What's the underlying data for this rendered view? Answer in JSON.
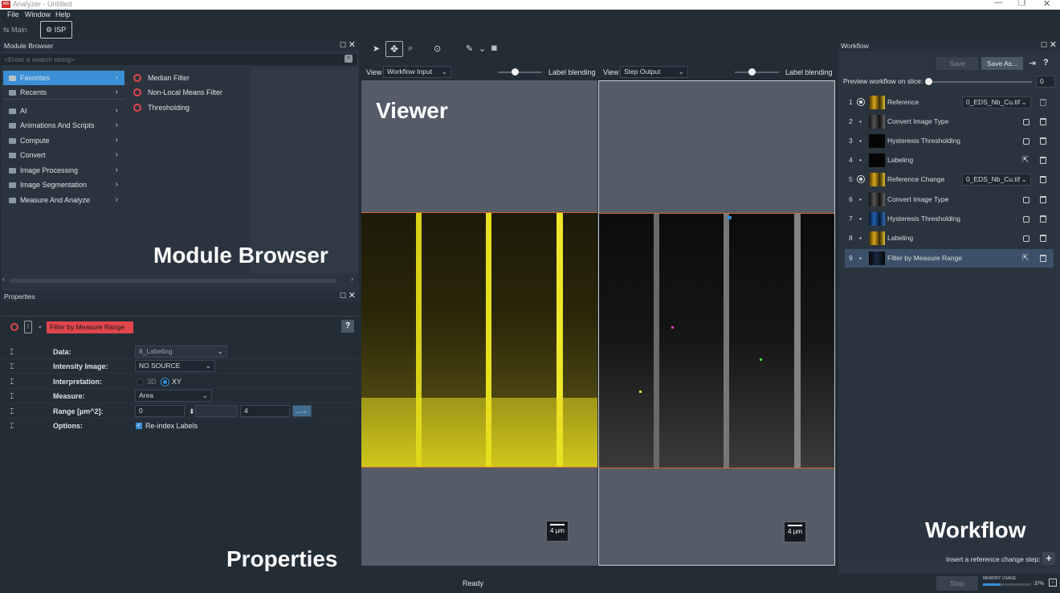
{
  "window": {
    "title": "Analyzer - Untitled",
    "icon_label": "ABI"
  },
  "menu": [
    "File",
    "Window",
    "Help"
  ],
  "perspectives": {
    "main": "Main",
    "isp": "ISP"
  },
  "module_browser": {
    "title": "Module Browser",
    "search_placeholder": "<Enter a search string>",
    "categories": [
      "Favorites",
      "Recents",
      "AI",
      "Animations And Scripts",
      "Compute",
      "Convert",
      "Image Processing",
      "Image Segmentation",
      "Measure And Analyze"
    ],
    "favorites": [
      "Median Filter",
      "Non-Local Means Filter",
      "Thresholding"
    ],
    "overlay_label": "Module Browser"
  },
  "properties": {
    "title": "Properties",
    "module_name": "Filter by Measure Range",
    "fields": [
      {
        "label": "Data:",
        "value": "8_Labeling"
      },
      {
        "label": "Intensity Image:",
        "value": "NO SOURCE"
      },
      {
        "label": "Interpretation:",
        "option_3d": "3D",
        "option_xy": "XY"
      },
      {
        "label": "Measure:",
        "value": "Area"
      },
      {
        "label": "Range [µm^2]:",
        "min": "0",
        "max": "4",
        "more": "..."
      },
      {
        "label": "Options:",
        "checkbox": "Re-index Labels"
      }
    ],
    "overlay_label": "Properties"
  },
  "viewer": {
    "overlay_label": "Viewer",
    "left": {
      "view_label": "View",
      "view_value": "Workflow Input",
      "blend_label": "Label blending",
      "scale": "4 µm"
    },
    "right": {
      "view_label": "View",
      "view_value": "Step Output",
      "blend_label": "Label blending",
      "scale": "4 µm"
    }
  },
  "workflow": {
    "title": "Workflow",
    "save": "Save",
    "save_as": "Save As...",
    "help": "?",
    "preview_label": "Preview workflow on slice:",
    "preview_value": "0",
    "steps": [
      {
        "num": "1",
        "name": "Reference",
        "combo": "0_EDS_Nb_Cu.tif",
        "thumb": "yellow"
      },
      {
        "num": "2",
        "name": "Convert Image Type",
        "thumb": "gray"
      },
      {
        "num": "3",
        "name": "Hysteresis Thresholding",
        "thumb": "dark"
      },
      {
        "num": "4",
        "name": "Labeling",
        "thumb": "dark"
      },
      {
        "num": "5",
        "name": "Reference Change",
        "combo": "0_EDS_Nb_Cu.tif",
        "thumb": "yellow"
      },
      {
        "num": "6",
        "name": "Convert Image Type",
        "thumb": "gray"
      },
      {
        "num": "7",
        "name": "Hysteresis Thresholding",
        "thumb": "blue"
      },
      {
        "num": "8",
        "name": "Labeling",
        "thumb": "yellow"
      },
      {
        "num": "9",
        "name": "Filter by Measure Range",
        "thumb": "dark"
      }
    ],
    "insert_label": "Insert a reference change step:",
    "overlay_label": "Workflow"
  },
  "status": {
    "text": "Ready",
    "stop": "Stop",
    "memory_label": "MEMORY USAGE",
    "memory_value": "37%",
    "memory_fraction": 0.37
  },
  "colors": {
    "accent": "#3a8fd6",
    "selected_row": "#3b5068",
    "module_badge": "#e0464c",
    "viewer_border": "#d36a2a"
  }
}
